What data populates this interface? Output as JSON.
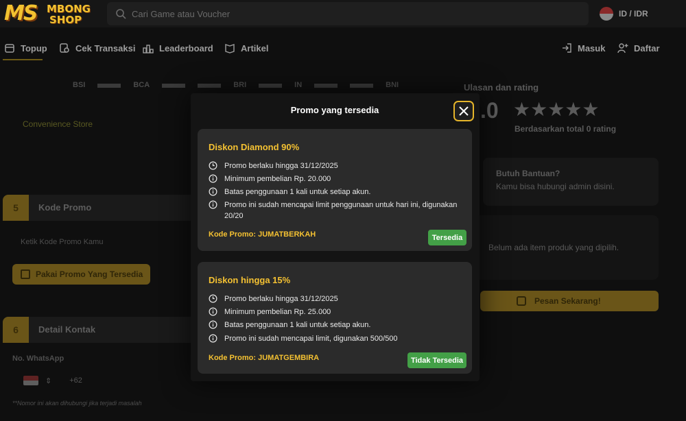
{
  "header": {
    "logo_ms": "MS",
    "logo_top": "MBONG",
    "logo_bottom": "SHOP",
    "search_placeholder": "Cari Game atau Voucher",
    "locale": "ID / IDR"
  },
  "nav": {
    "items": [
      {
        "label": "Topup",
        "icon": "topup-icon"
      },
      {
        "label": "Cek Transaksi",
        "icon": "receipt-icon"
      },
      {
        "label": "Leaderboard",
        "icon": "leaderboard-icon"
      },
      {
        "label": "Artikel",
        "icon": "article-icon"
      }
    ],
    "login": "Masuk",
    "register": "Daftar"
  },
  "background": {
    "payment_logos": [
      "BSI",
      "",
      "BCA",
      "",
      "",
      "BRI",
      "",
      "IN",
      "",
      "",
      "BNI"
    ],
    "convenience_store": "Convenience Store",
    "section5": {
      "number": "5",
      "title": "Kode Promo",
      "hint": "Ketik Kode Promo Kamu",
      "button": "Pakai Promo Yang Tersedia"
    },
    "section6": {
      "number": "6",
      "title": "Detail Kontak",
      "whatsapp_label": "No. WhatsApp",
      "prefix": "+62",
      "note": "**Nomor ini akan dihubungi jika terjadi masalah"
    },
    "reviews": {
      "title": "Ulasan dan rating",
      "score": ".0",
      "stars": "★★★★★",
      "based_on": "Berdasarkan total 0 rating"
    },
    "help": {
      "title": "Butuh Bantuan?",
      "subtitle": "Kamu bisa hubungi admin disini."
    },
    "empty_cart": "Belum ada item produk yang dipilih.",
    "order_button": "Pesan Sekarang!"
  },
  "modal": {
    "title": "Promo yang tersedia",
    "promos": [
      {
        "name": "Diskon Diamond 90%",
        "lines": [
          "Promo berlaku hingga 31/12/2025",
          "Minimum pembelian Rp. 20.000",
          "Batas penggunaan 1 kali untuk setiap akun.",
          "Promo ini sudah mencapai limit penggunaan untuk hari ini, digunakan 20/20"
        ],
        "code": "Kode Promo: JUMATBERKAH",
        "status": "Tersedia"
      },
      {
        "name": "Diskon hingga 15%",
        "lines": [
          "Promo berlaku hingga 31/12/2025",
          "Minimum pembelian Rp. 25.000",
          "Batas penggunaan 1 kali untuk setiap akun.",
          "Promo ini sudah mencapai limit, digunakan 500/500"
        ],
        "code": "Kode Promo: JUMATGEMBIRA",
        "status": "Tidak Tersedia"
      }
    ]
  },
  "colors": {
    "accent": "#f4c132",
    "success": "#43a047",
    "panel": "#2b2b2b"
  }
}
